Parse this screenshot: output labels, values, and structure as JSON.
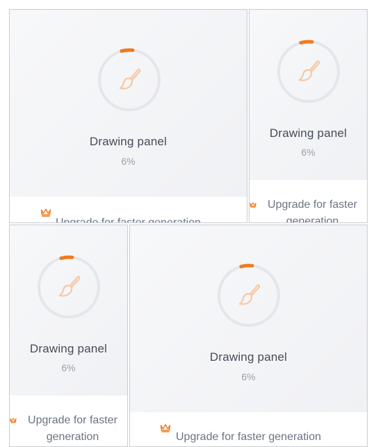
{
  "panels": [
    {
      "title": "Drawing panel",
      "progress_label": "6%",
      "progress": 0.06,
      "upgrade_label": "Upgrade for faster generation"
    },
    {
      "title": "Drawing panel",
      "progress_label": "6%",
      "progress": 0.06,
      "upgrade_label": "Upgrade for faster generation"
    },
    {
      "title": "Drawing panel",
      "progress_label": "6%",
      "progress": 0.06,
      "upgrade_label": "Upgrade for faster generation"
    },
    {
      "title": "Drawing panel",
      "progress_label": "6%",
      "progress": 0.06,
      "upgrade_label": "Upgrade for faster generation"
    }
  ],
  "colors": {
    "accent": "#f07a1f",
    "ring_track": "#e5e6ea",
    "brush": "#f6c9a3",
    "crown": "#f07a1f"
  },
  "icons": {
    "status": "paintbrush-icon",
    "upgrade": "crown-icon"
  }
}
